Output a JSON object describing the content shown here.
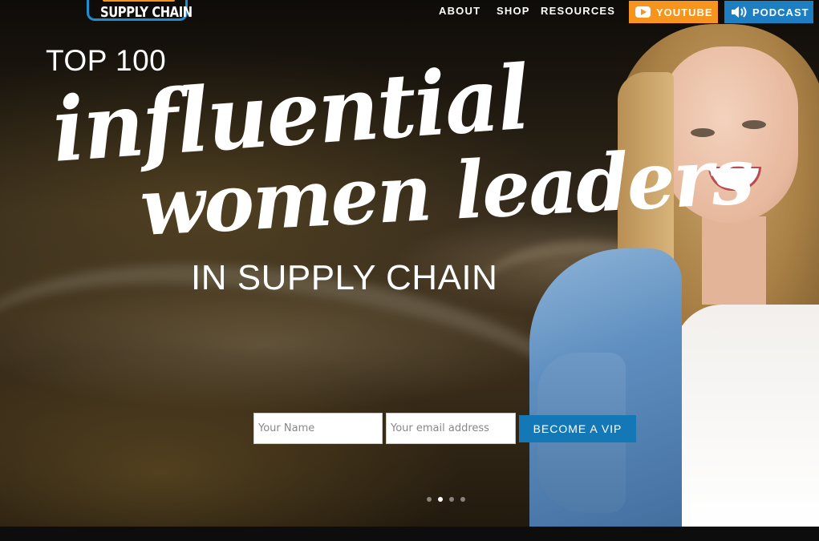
{
  "logo": {
    "text": "SUPPLY CHAIN"
  },
  "nav": {
    "items": [
      "ABOUT",
      "SHOP",
      "RESOURCES"
    ]
  },
  "header_buttons": {
    "youtube": {
      "label": "YOUTUBE",
      "icon": "youtube-icon",
      "color": "#f7941d"
    },
    "podcast": {
      "label": "PODCAST",
      "icon": "speaker-icon",
      "color": "#1d7fc1"
    }
  },
  "hero": {
    "pre_title": "TOP 100",
    "script_line_1": "influential",
    "script_line_2": "women leaders",
    "subtitle": "IN SUPPLY CHAIN"
  },
  "form": {
    "name_placeholder": "Your Name",
    "email_placeholder": "Your email address",
    "submit_label": "BECOME A VIP",
    "submit_color": "#1378b5"
  },
  "slider": {
    "dot_count": 4,
    "active_index": 1
  }
}
